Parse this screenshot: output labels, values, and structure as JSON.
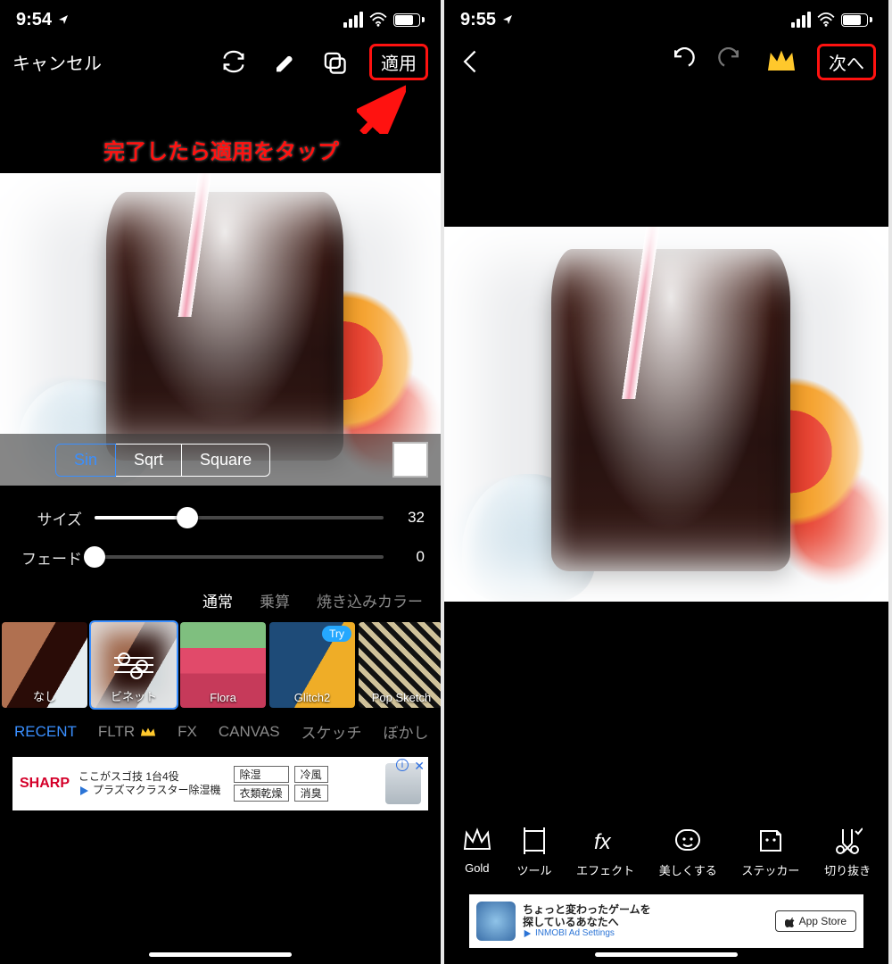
{
  "left": {
    "status_time": "9:54",
    "toolbar": {
      "cancel": "キャンセル",
      "apply": "適用"
    },
    "annotation": "完了したら適用をタップ",
    "segments": {
      "sin": "Sin",
      "sqrt": "Sqrt",
      "square": "Square"
    },
    "sliders": {
      "size_label": "サイズ",
      "size_value": "32",
      "fade_label": "フェード",
      "fade_value": "0"
    },
    "blend": {
      "normal": "通常",
      "multiply": "乗算",
      "colorburn": "焼き込みカラー"
    },
    "effects": {
      "none": "なし",
      "vignette": "ビネット",
      "flora": "Flora",
      "glitch": "Glitch2",
      "pop": "Pop Sketch",
      "try": "Try"
    },
    "cats": {
      "recent": "RECENT",
      "fltr": "FLTR",
      "fx": "FX",
      "canvas": "CANVAS",
      "sketch": "スケッチ",
      "blur": "ぼかし"
    },
    "ad": {
      "brand": "SHARP",
      "line1": "ここがスゴ技 1台4役",
      "line2": "プラズマクラスター除湿機",
      "tag1": "除湿",
      "tag2": "冷風",
      "tag3": "衣類乾燥",
      "tag4": "消臭"
    }
  },
  "right": {
    "status_time": "9:55",
    "toolbar": {
      "next": "次へ"
    },
    "tools": {
      "gold": "Gold",
      "tool": "ツール",
      "effect": "エフェクト",
      "beauty": "美しくする",
      "sticker": "ステッカー",
      "cutout": "切り抜き"
    },
    "ad": {
      "line1": "ちょっと変わったゲームを",
      "line2": "探しているあなたへ",
      "line3": "INMOBI  Ad Settings",
      "btn": "App Store"
    }
  }
}
